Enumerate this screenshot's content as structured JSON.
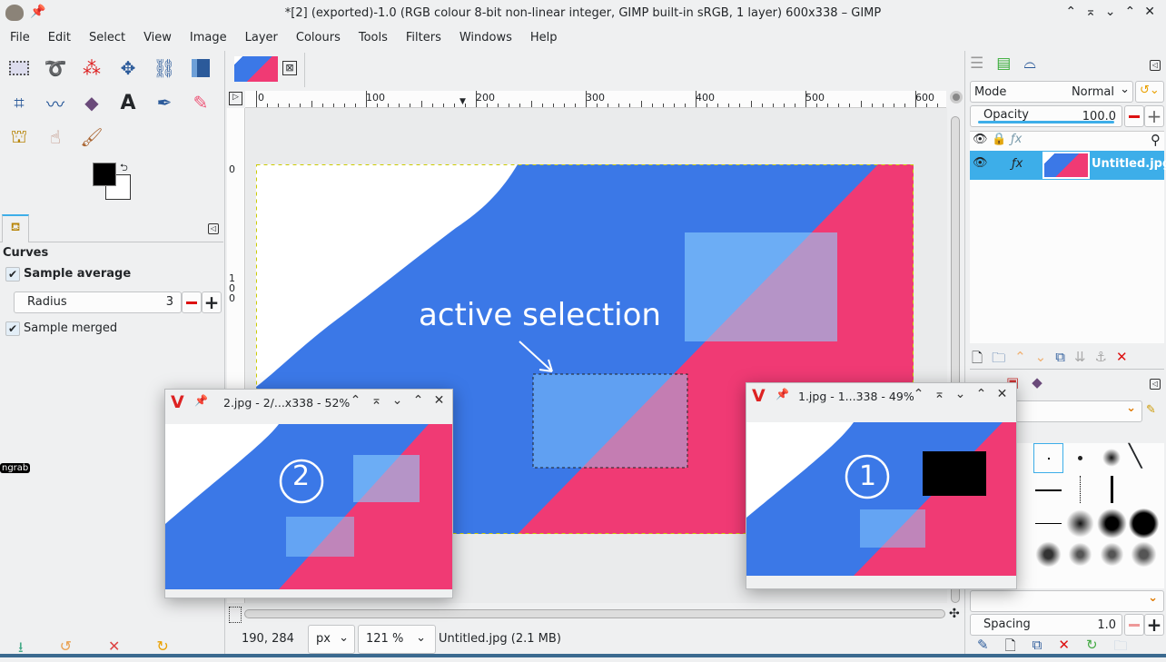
{
  "window": {
    "title": "*[2] (exported)-1.0 (RGB colour 8-bit non-linear integer, GIMP built-in sRGB, 1 layer) 600x338 – GIMP"
  },
  "menu": [
    "File",
    "Edit",
    "Select",
    "View",
    "Image",
    "Layer",
    "Colours",
    "Tools",
    "Filters",
    "Windows",
    "Help"
  ],
  "tool_options": {
    "title": "Curves",
    "sample_average": "Sample average",
    "radius_label": "Radius",
    "radius_value": "3",
    "sample_merged": "Sample merged"
  },
  "side_label": "ngrab",
  "rulers": {
    "top": [
      "0",
      "100",
      "200",
      "300",
      "400",
      "500",
      "600"
    ],
    "left": [
      "0",
      "1",
      "0",
      "0"
    ]
  },
  "canvas": {
    "annotation": "active selection"
  },
  "status": {
    "coords": "190, 284",
    "unit": "px",
    "zoom": "121 %",
    "file": "Untitled.jpg (2.1 MB)"
  },
  "layers": {
    "mode_label": "Mode",
    "mode_value": "Normal",
    "opacity_label": "Opacity",
    "opacity_value": "100.0",
    "opacity_percent": 100,
    "layer_name": "Untitled.jpg"
  },
  "brushes": {
    "spacing_label": "Spacing",
    "spacing_value": "1.0"
  },
  "viewer2": {
    "title": "2.jpg - 2/...x338 - 52%",
    "badge": "②"
  },
  "viewer1": {
    "title": "1.jpg - 1...338 - 49%",
    "badge": "①"
  },
  "colors": {
    "blue": "#3b78e7",
    "pink": "#f03a74",
    "accent": "#3daee9"
  }
}
